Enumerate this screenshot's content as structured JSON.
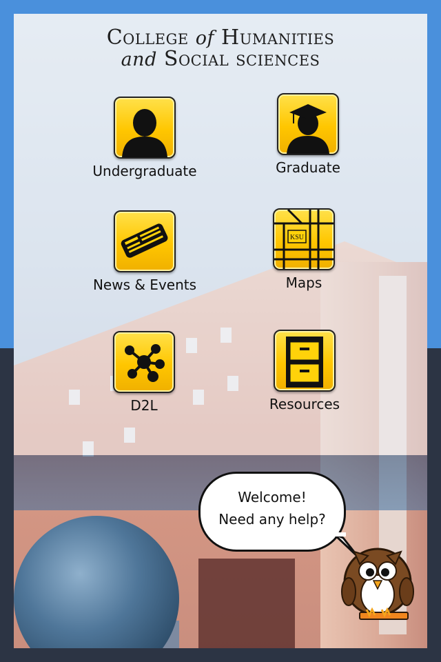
{
  "header": {
    "line1_a": "College ",
    "line1_b": "of",
    "line1_c": " Humanities",
    "line2_a": "and",
    "line2_b": " Social sciences"
  },
  "menu": {
    "undergraduate": {
      "label": "Undergraduate",
      "icon": "student-silhouette-icon"
    },
    "graduate": {
      "label": "Graduate",
      "icon": "graduate-cap-icon"
    },
    "news": {
      "label": "News & Events",
      "icon": "newspaper-icon"
    },
    "maps": {
      "label": "Maps",
      "icon": "map-icon",
      "badge": "KSU"
    },
    "d2l": {
      "label": "D2L",
      "icon": "network-nodes-icon"
    },
    "resources": {
      "label": "Resources",
      "icon": "file-cabinet-icon"
    }
  },
  "bubble": {
    "line1": "Welcome!",
    "line2": "Need any help?"
  },
  "colors": {
    "icon_yellow": "#ffc600",
    "frame_blue": "#4a90dc",
    "frame_dark": "#2c3444"
  }
}
